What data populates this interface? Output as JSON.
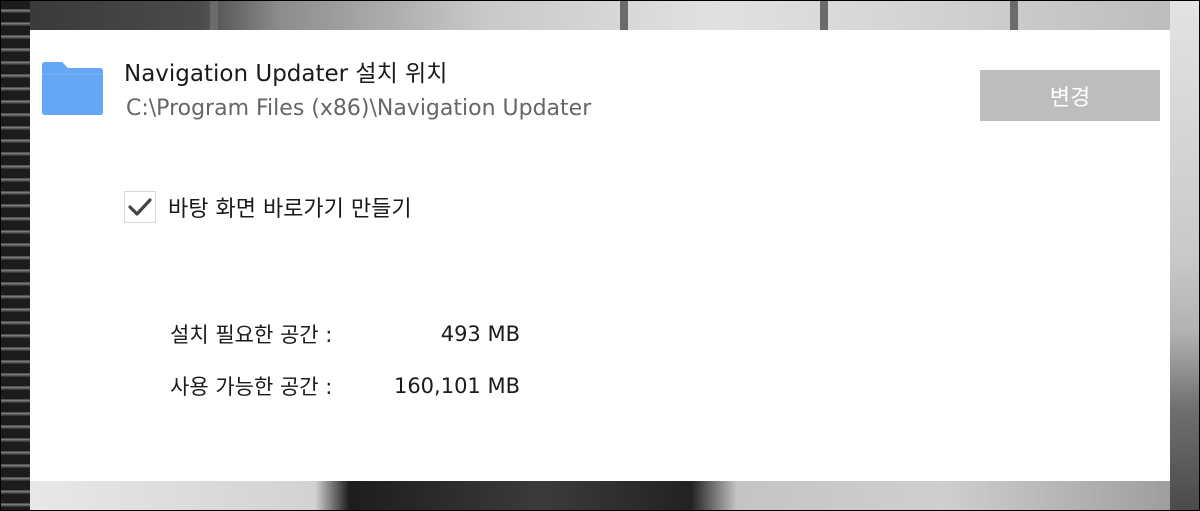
{
  "install_location": {
    "title": "Navigation Updater 설치 위치",
    "path": "C:\\Program Files (x86)\\Navigation Updater",
    "change_button_label": "변경",
    "folder_icon": "folder-icon",
    "folder_color": "#64a7f5"
  },
  "desktop_shortcut": {
    "label": "바탕 화면 바로가기 만들기",
    "checked": true
  },
  "disk_space": {
    "required_label": "설치 필요한 공간 :",
    "required_value": "493 MB",
    "available_label": "사용 가능한 공간 :",
    "available_value": "160,101 MB"
  },
  "colors": {
    "button_bg": "#bdbdbd",
    "path_text": "#666666",
    "dialog_bg": "#ffffff"
  }
}
